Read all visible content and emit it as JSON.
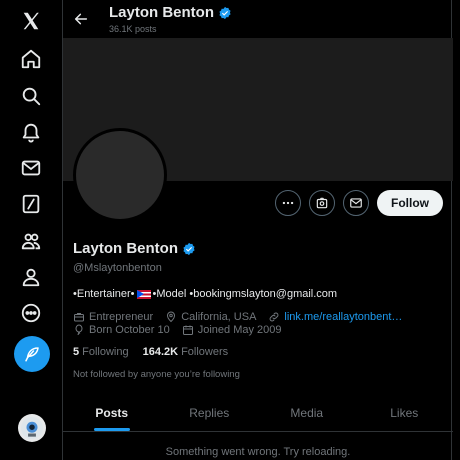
{
  "nav": {
    "items": [
      "x-logo-icon",
      "home-icon",
      "explore-icon",
      "notifications-icon",
      "messages-icon",
      "grok-icon",
      "communities-icon",
      "profile-icon",
      "more-icon"
    ]
  },
  "header": {
    "name": "Layton Benton",
    "posts_count": "36.1K posts"
  },
  "profile": {
    "name": "Layton Benton",
    "handle": "@Mslaytonbenton",
    "bio_prefix": "•Entertainer•",
    "bio_suffix": "•Model •bookingmslayton@gmail.com",
    "category": "Entrepreneur",
    "location": "California, USA",
    "website": "link.me/reallaytonbent…",
    "birthday": "Born October 10",
    "joined": "Joined May 2009",
    "following_count": "5",
    "following_label": "Following",
    "followers_count": "164.2K",
    "followers_label": "Followers",
    "not_followed": "Not followed by anyone you’re following",
    "follow_button": "Follow"
  },
  "tabs": [
    "Posts",
    "Replies",
    "Media",
    "Likes"
  ],
  "error_message": "Something went wrong. Try reloading.",
  "colors": {
    "accent": "#1d9bf0",
    "background": "#000000",
    "muted": "#71767b"
  }
}
